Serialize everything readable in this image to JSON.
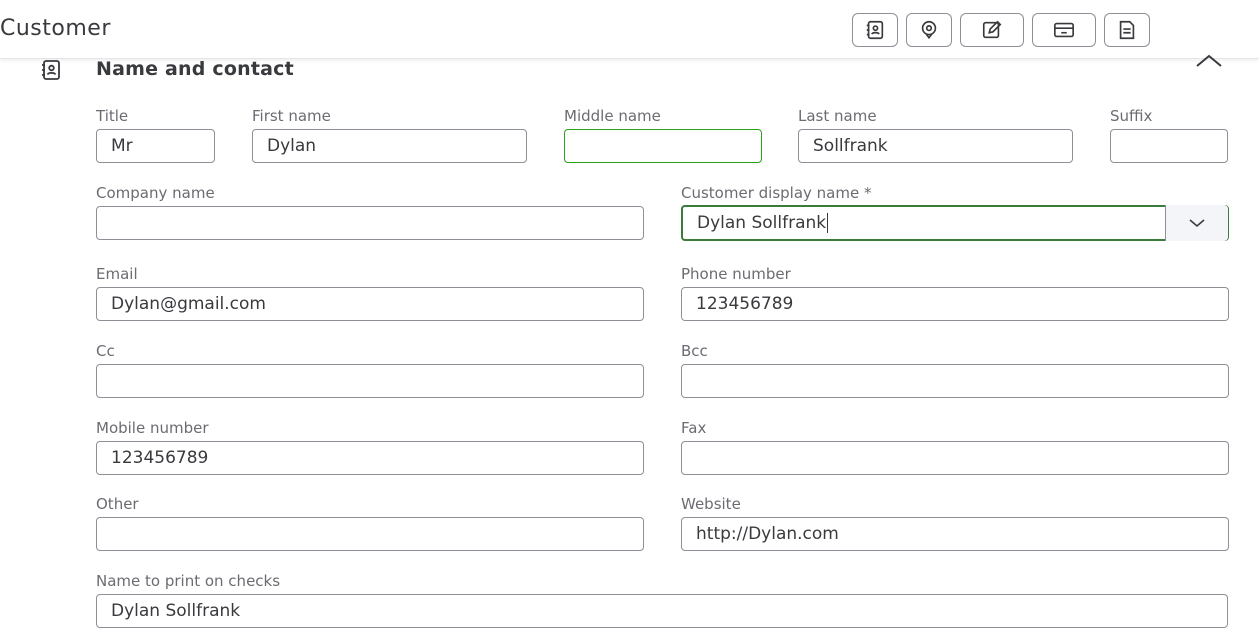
{
  "header": {
    "title": "Customer",
    "toolbar": [
      {
        "name": "contact-card-icon"
      },
      {
        "name": "location-pin-icon"
      },
      {
        "name": "edit-note-icon"
      },
      {
        "name": "payment-card-icon"
      },
      {
        "name": "document-icon"
      }
    ]
  },
  "section": {
    "title": "Name and contact",
    "icon": "contact-card-icon",
    "collapse_icon": "chevron-up-icon"
  },
  "fields": {
    "title": {
      "label": "Title",
      "value": "Mr"
    },
    "first_name": {
      "label": "First name",
      "value": "Dylan"
    },
    "middle_name": {
      "label": "Middle name",
      "value": ""
    },
    "last_name": {
      "label": "Last name",
      "value": "Sollfrank"
    },
    "suffix": {
      "label": "Suffix",
      "value": ""
    },
    "company_name": {
      "label": "Company name",
      "value": ""
    },
    "display_name": {
      "label": "Customer display name *",
      "value": "Dylan Sollfrank"
    },
    "email": {
      "label": "Email",
      "value": "Dylan@gmail.com"
    },
    "phone": {
      "label": "Phone number",
      "value": "123456789"
    },
    "cc": {
      "label": "Cc",
      "value": ""
    },
    "bcc": {
      "label": "Bcc",
      "value": ""
    },
    "mobile": {
      "label": "Mobile number",
      "value": "123456789"
    },
    "fax": {
      "label": "Fax",
      "value": ""
    },
    "other": {
      "label": "Other",
      "value": ""
    },
    "website": {
      "label": "Website",
      "value": "http://Dylan.com"
    },
    "print_name": {
      "label": "Name to print on checks",
      "value": "Dylan Sollfrank"
    }
  },
  "colors": {
    "text": "#393a3d",
    "label": "#6b6c72",
    "border": "#8d9096",
    "focus_green": "#2ca01c"
  }
}
